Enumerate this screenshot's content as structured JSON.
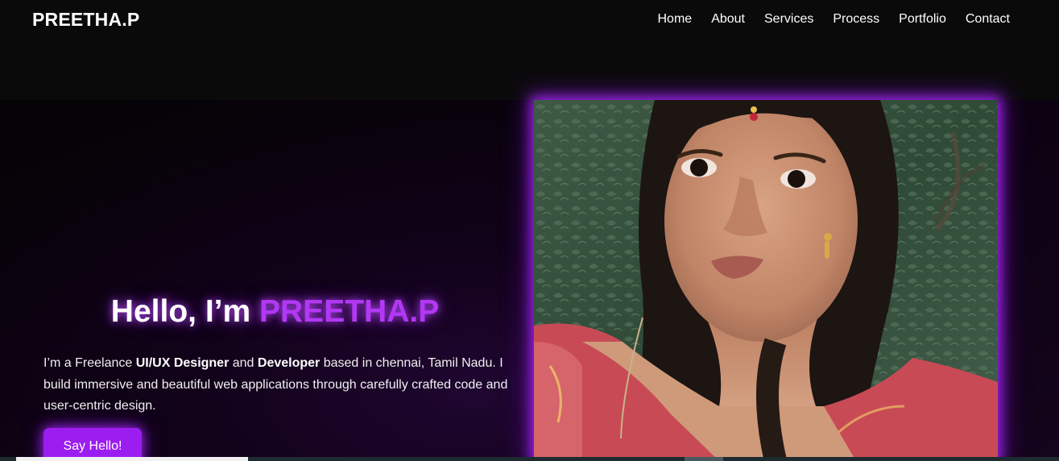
{
  "header": {
    "logo": "PREETHA.P",
    "nav": [
      {
        "label": "Home"
      },
      {
        "label": "About"
      },
      {
        "label": "Services"
      },
      {
        "label": "Process"
      },
      {
        "label": "Portfolio"
      },
      {
        "label": "Contact"
      }
    ]
  },
  "hero": {
    "greeting": "Hello, I’m ",
    "name": "PREETHA.P",
    "desc_part1": "I’m a Freelance ",
    "desc_role1": "UI/UX Designer",
    "desc_part2": " and ",
    "desc_role2": "Developer",
    "desc_part3": " based in chennai, Tamil Nadu. I build immersive and beautiful web applications through carefully crafted code and user-centric design.",
    "cta_label": "Say Hello!",
    "photo_description": "portrait-photo"
  },
  "colors": {
    "background": "#0a0a0a",
    "accent": "#b238f5",
    "button": "#9b1df0",
    "text": "#ffffff"
  }
}
